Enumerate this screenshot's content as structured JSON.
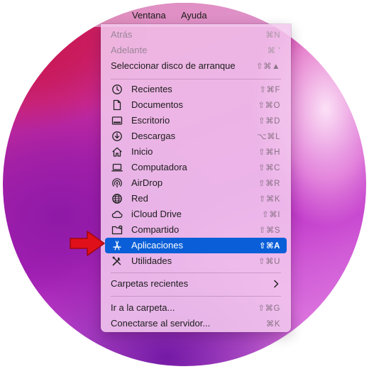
{
  "menubar": {
    "ventana": "Ventana",
    "ayuda": "Ayuda"
  },
  "menu": {
    "nav": [
      {
        "label": "Atrás",
        "shortcut": "⌘N",
        "disabled": true
      },
      {
        "label": "Adelante",
        "shortcut": "⌘ '",
        "disabled": true
      },
      {
        "label": "Seleccionar disco de arranque",
        "shortcut": "⇧⌘▲",
        "disabled": false
      }
    ],
    "places": [
      {
        "label": "Recientes",
        "shortcut": "⇧⌘F",
        "icon": "clock-icon"
      },
      {
        "label": "Documentos",
        "shortcut": "⇧⌘O",
        "icon": "document-icon"
      },
      {
        "label": "Escritorio",
        "shortcut": "⇧⌘D",
        "icon": "desktop-icon"
      },
      {
        "label": "Descargas",
        "shortcut": "⌥⌘L",
        "icon": "download-icon"
      },
      {
        "label": "Inicio",
        "shortcut": "⇧⌘H",
        "icon": "home-icon"
      },
      {
        "label": "Computadora",
        "shortcut": "⇧⌘C",
        "icon": "laptop-icon"
      },
      {
        "label": "AirDrop",
        "shortcut": "⇧⌘R",
        "icon": "airdrop-icon"
      },
      {
        "label": "Red",
        "shortcut": "⇧⌘K",
        "icon": "globe-icon"
      },
      {
        "label": "iCloud Drive",
        "shortcut": "⇧⌘I",
        "icon": "cloud-icon"
      },
      {
        "label": "Compartido",
        "shortcut": "⇧⌘S",
        "icon": "shared-folder-icon"
      },
      {
        "label": "Aplicaciones",
        "shortcut": "⇧⌘A",
        "icon": "applications-icon",
        "selected": true
      },
      {
        "label": "Utilidades",
        "shortcut": "⇧⌘U",
        "icon": "utilities-icon"
      }
    ],
    "recent_folders": {
      "label": "Carpetas recientes",
      "icon": "chevron-right-icon"
    },
    "goto": [
      {
        "label": "Ir a la carpeta...",
        "shortcut": "⇧⌘G"
      },
      {
        "label": "Conectarse al servidor...",
        "shortcut": "⌘K"
      }
    ]
  },
  "colors": {
    "selection": "#0a5fd8",
    "arrow": "#e0101a",
    "menu_background": "#f2c8ee"
  }
}
